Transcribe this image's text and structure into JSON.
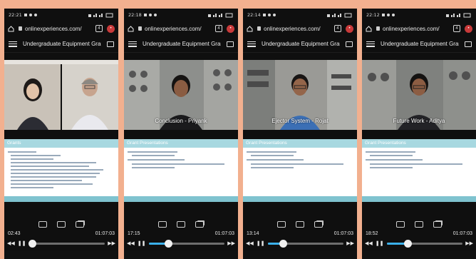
{
  "phones": [
    {
      "status_time": "22:21",
      "url": "onlinexperiences.com/",
      "tab_count": "4",
      "app_title": "Undergraduate Equipment Grant ...",
      "video_caption": "",
      "slide_heading": "Grants",
      "elapsed": "02:43",
      "duration": "01:07:03",
      "progress": 0.04
    },
    {
      "status_time": "22:18",
      "url": "onlinexperiences.com/",
      "tab_count": "4",
      "app_title": "Undergraduate Equipment Grant ...",
      "video_caption": "Conclusion - Priyank",
      "slide_heading": "Grant Presentations",
      "elapsed": "17:15",
      "duration": "01:07:03",
      "progress": 0.26
    },
    {
      "status_time": "22:14",
      "url": "onlinexperiences.com/",
      "tab_count": "4",
      "app_title": "Undergraduate Equipment Grant ...",
      "video_caption": "Ejector System - Rojat",
      "slide_heading": "Grant Presentations",
      "elapsed": "13:14",
      "duration": "01:07:03",
      "progress": 0.2
    },
    {
      "status_time": "22:12",
      "url": "onlinexperiences.com/",
      "tab_count": "4",
      "app_title": "Undergraduate Equipment Grant ...",
      "video_caption": "Future Work - Aditya",
      "slide_heading": "Grant Presentations",
      "elapsed": "18:52",
      "duration": "01:07:03",
      "progress": 0.28
    }
  ]
}
